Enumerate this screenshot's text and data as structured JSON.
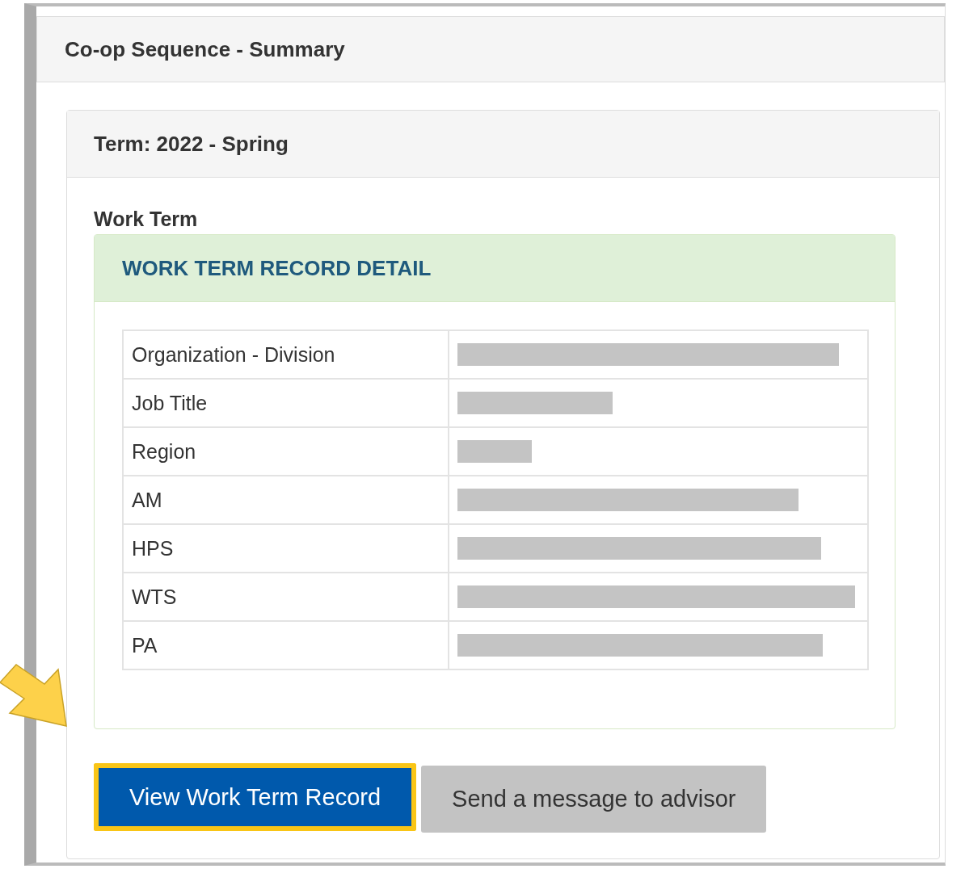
{
  "panel": {
    "title": "Co-op Sequence - Summary"
  },
  "term": {
    "title": "Term: 2022 - Spring",
    "section_label": "Work Term",
    "record": {
      "title": "WORK TERM RECORD DETAIL",
      "rows": [
        {
          "label": "Organization - Division",
          "value": {
            "kind": "redacted"
          }
        },
        {
          "label": "Job Title",
          "value": {
            "kind": "redacted"
          }
        },
        {
          "label": "Region",
          "value": {
            "kind": "redacted"
          }
        },
        {
          "label": "AM",
          "value": {
            "kind": "redacted"
          }
        },
        {
          "label": "HPS",
          "value": {
            "kind": "redacted"
          }
        },
        {
          "label": "WTS",
          "value": {
            "kind": "redacted"
          }
        },
        {
          "label": "PA",
          "value": {
            "kind": "redacted"
          }
        }
      ]
    }
  },
  "buttons": [
    {
      "label": "View Work Term Record",
      "kind": "primary",
      "highlighted": true
    },
    {
      "label": "Send a message to advisor",
      "kind": "secondary",
      "highlighted": false
    }
  ],
  "annotation": {
    "kind": "arrow"
  }
}
